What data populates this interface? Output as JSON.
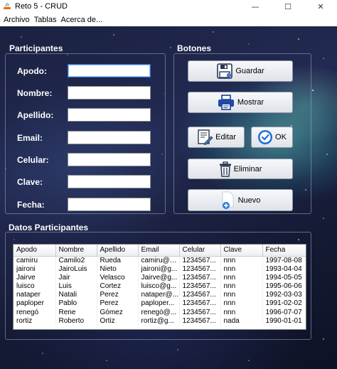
{
  "window": {
    "title": "Reto 5 - CRUD",
    "minimize": "—",
    "maximize": "☐",
    "close": "✕"
  },
  "menu": [
    "Archivo",
    "Tablas",
    "Acerca de..."
  ],
  "participants_panel": {
    "title": "Participantes",
    "fields": [
      {
        "label": "Apodo:",
        "value": ""
      },
      {
        "label": "Nombre:",
        "value": ""
      },
      {
        "label": "Apellido:",
        "value": ""
      },
      {
        "label": "Email:",
        "value": ""
      },
      {
        "label": "Celular:",
        "value": ""
      },
      {
        "label": "Clave:",
        "value": ""
      },
      {
        "label": "Fecha:",
        "value": ""
      }
    ]
  },
  "buttons_panel": {
    "title": "Botones",
    "guardar": "Guardar",
    "mostrar": "Mostrar",
    "editar": "Editar",
    "ok": "OK",
    "eliminar": "Eliminar",
    "nuevo": "Nuevo"
  },
  "table_panel": {
    "title": "Datos Participantes",
    "columns": [
      "Apodo",
      "Nombre",
      "Apellido",
      "Email",
      "Celular",
      "Clave",
      "Fecha"
    ],
    "rows": [
      [
        "camiru",
        "Camilo2",
        "Rueda",
        "camiru@g...",
        "1234567...",
        "nnn",
        "1997-08-08"
      ],
      [
        "jaironi",
        "JairoLuis",
        "Nieto",
        "jaironi@g...",
        "1234567...",
        "nnn",
        "1993-04-04"
      ],
      [
        "Jairve",
        "Jair",
        "Velasco",
        "Jairve@g...",
        "1234567...",
        "nnn",
        "1994-05-05"
      ],
      [
        "luisco",
        "Luis",
        "Cortez",
        "luisco@g...",
        "1234567...",
        "nnn",
        "1995-06-06"
      ],
      [
        "nataper",
        "Natali",
        "Perez",
        "nataper@...",
        "1234567...",
        "nnn",
        "1992-03-03"
      ],
      [
        "paploper",
        "Pablo",
        "Perez",
        "paploper...",
        "1234567...",
        "nnn",
        "1991-02-02"
      ],
      [
        "renegó",
        "Rene",
        "Gómez",
        "renegó@...",
        "1234567...",
        "nnn",
        "1996-07-07"
      ],
      [
        "rortiz",
        "Roberto",
        "Ortiz",
        "rortiz@g...",
        "1234567...",
        "nada",
        "1990-01-01"
      ]
    ]
  }
}
